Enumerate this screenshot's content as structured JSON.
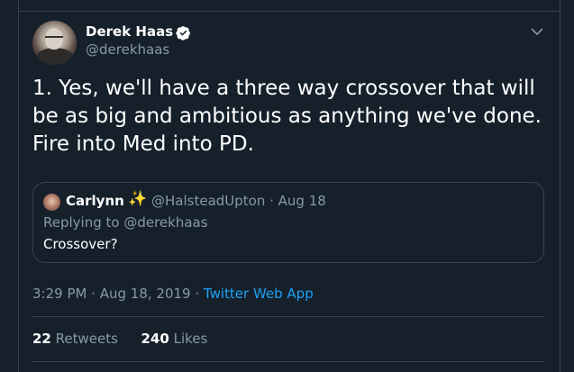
{
  "tweet": {
    "author_name": "Derek Haas",
    "author_handle": "@derekhaas",
    "text": "1.  Yes, we'll have a three way crossover that will be as big and ambitious as anything we've done.  Fire into Med into PD.",
    "time": "3:29 PM · Aug 18, 2019 · ",
    "source": "Twitter Web App",
    "retweets_count": "22",
    "retweets_label": "Retweets",
    "likes_count": "240",
    "likes_label": "Likes"
  },
  "quoted": {
    "author_name": "Carlynn",
    "sparkle": "✨",
    "handle_date": "@HalsteadUpton · Aug 18",
    "replying": "Replying to @derekhaas",
    "text": "Crossover?"
  },
  "colors": {
    "background": "#15202b",
    "border": "#38444d",
    "secondary_text": "#8899a6",
    "link": "#1da1f2",
    "verified": "#ffffff"
  },
  "icons": {
    "verified": "verified-badge-icon",
    "caret": "chevron-down-icon"
  }
}
